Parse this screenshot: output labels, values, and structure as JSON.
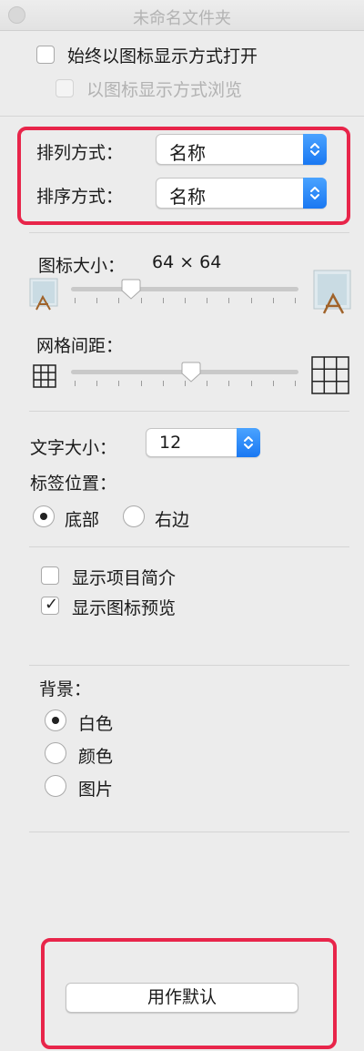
{
  "window": {
    "title": "未命名文件夹"
  },
  "options": {
    "always_open_icon_view": {
      "label": "始终以图标显示方式打开",
      "checked": false
    },
    "browse_icon_view": {
      "label": "以图标显示方式浏览",
      "checked": false,
      "enabled": false
    }
  },
  "arrange": {
    "arrange_by_label": "排列方式：",
    "arrange_by_value": "名称",
    "sort_by_label": "排序方式：",
    "sort_by_value": "名称"
  },
  "icon_size": {
    "label": "图标大小：",
    "value": "64 × 64",
    "slider_fraction": 0.24
  },
  "grid_spacing": {
    "label": "网格间距：",
    "slider_fraction": 0.53
  },
  "text_size": {
    "label": "文字大小：",
    "value": "12"
  },
  "label_position": {
    "label": "标签位置：",
    "options": [
      {
        "label": "底部",
        "selected": true
      },
      {
        "label": "右边",
        "selected": false
      }
    ]
  },
  "info": {
    "show_item_info": {
      "label": "显示项目简介",
      "checked": false
    },
    "show_icon_preview": {
      "label": "显示图标预览",
      "checked": true
    }
  },
  "background": {
    "label": "背景：",
    "options": [
      {
        "label": "白色",
        "selected": true
      },
      {
        "label": "颜色",
        "selected": false
      },
      {
        "label": "图片",
        "selected": false
      }
    ]
  },
  "footer": {
    "use_as_defaults_label": "用作默认"
  },
  "colors": {
    "highlight": "#e8254a",
    "accent": "#1a78f2",
    "background": "#ececec"
  }
}
